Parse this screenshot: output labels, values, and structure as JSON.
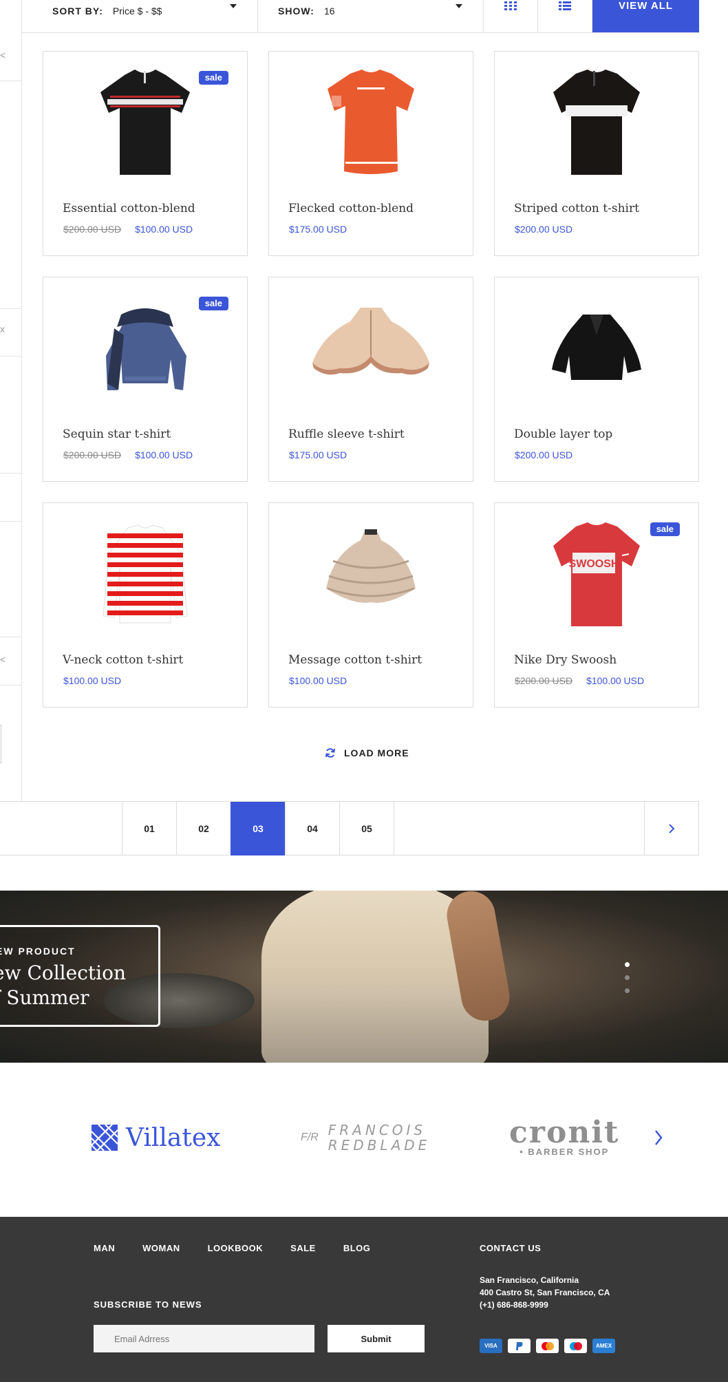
{
  "toolbar": {
    "sort_label": "SORT BY:",
    "sort_value": "Price $ - $$",
    "show_label": "SHOW:",
    "show_value": "16",
    "grid_icon": "grid-view-icon",
    "list_icon": "list-view-icon",
    "view_all": "VIEW ALL"
  },
  "sidebar": {
    "marks": [
      "<",
      "x",
      "<"
    ]
  },
  "products": [
    {
      "name": "Essential cotton-blend",
      "old_price": "$200.00 USD",
      "price": "$100.00 USD",
      "badge": "sale"
    },
    {
      "name": "Flecked cotton-blend",
      "old_price": "",
      "price": "$175.00 USD",
      "badge": ""
    },
    {
      "name": "Striped cotton t-shirt",
      "old_price": "",
      "price": "$200.00 USD",
      "badge": ""
    },
    {
      "name": "Sequin star t-shirt",
      "old_price": "$200.00 USD",
      "price": "$100.00 USD",
      "badge": "sale"
    },
    {
      "name": "Ruffle sleeve t-shirt",
      "old_price": "",
      "price": "$175.00 USD",
      "badge": ""
    },
    {
      "name": "Double layer top",
      "old_price": "",
      "price": "$200.00 USD",
      "badge": ""
    },
    {
      "name": "V-neck cotton t-shirt",
      "old_price": "",
      "price": "$100.00 USD",
      "badge": ""
    },
    {
      "name": "Message cotton t-shirt",
      "old_price": "",
      "price": "$100.00 USD",
      "badge": ""
    },
    {
      "name": "Nike Dry Swoosh",
      "old_price": "$200.00 USD",
      "price": "$100.00 USD",
      "badge": "sale"
    }
  ],
  "load_more": "LOAD MORE",
  "pagination": {
    "pages": [
      "01",
      "02",
      "03",
      "04",
      "05"
    ],
    "active": "03"
  },
  "banner": {
    "kicker": "EW PRODUCT",
    "title_line1": "ew Collection",
    "title_line2": "f Summer"
  },
  "brands": {
    "villatex": "Villatex",
    "francois_mark": "F/R",
    "francois_line1": "FRANCOIS",
    "francois_line2": "REDBLADE",
    "cronit_big": "cronit",
    "cronit_small": "• BARBER  SHOP"
  },
  "footer": {
    "nav": [
      "MAN",
      "WOMAN",
      "LOOKBOOK",
      "SALE",
      "BLOG"
    ],
    "subscribe_title": "SUBSCRIBE TO NEWS",
    "email_placeholder": "Email Adrress",
    "submit": "Submit",
    "contact_title": "CONTACT US",
    "address_line1": "San Francisco, California",
    "address_line2": "400 Castro St, San Francisco, CA",
    "phone": "(+1) 686-868-9999",
    "payments": [
      "VISA",
      "PayPal",
      "Mastercard",
      "Maestro",
      "AMEX"
    ]
  },
  "colors": {
    "accent": "#3b55d9",
    "footer_bg": "#393939"
  }
}
